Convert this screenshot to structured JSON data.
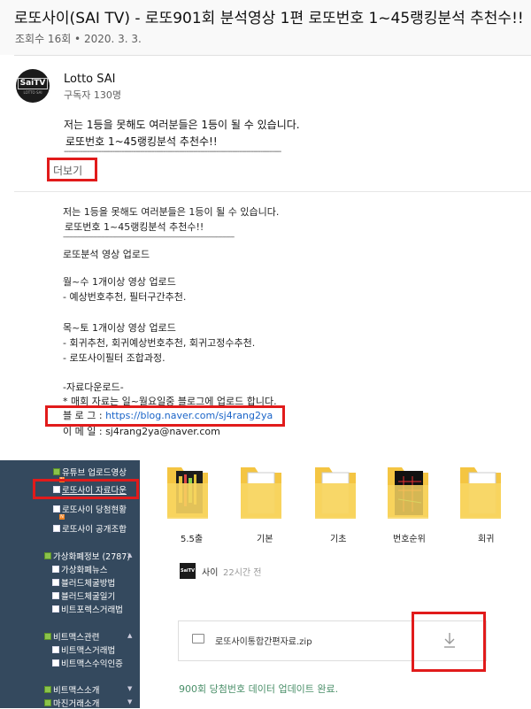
{
  "video": {
    "title": "로또사이(SAI TV) - 로또901회 분석영상 1편 로또번호 1~45랭킹분석 추천수!!",
    "meta": "조회수 16회 • 2020. 3. 3."
  },
  "channel": {
    "name": "Lotto SAI",
    "subscribers": "구독자 130명",
    "avatar_text": "SaiTV",
    "avatar_subtext": "LOTTO SAI"
  },
  "description": {
    "line1": "저는 1등을 못해도 여러분들은 1등이 될 수 있습니다.",
    "line2": "로또번호 1~45랭킹분석 추천수!!",
    "separator": "----------------------------------------------------------------------------------------------",
    "more_label": "더보기"
  },
  "expanded": {
    "line1": "저는 1등을 못해도 여러분들은 1등이 될 수 있습니다.",
    "line2": "로또번호 1~45랭킹분석 추천수!!",
    "separator": "--------------------------------------------------------------------------------------",
    "upload_heading": "로또분석 영상 업로드",
    "mon_wed": "월~수 1개이상 영상 업로드",
    "mon_wed_detail": "- 예상번호추천, 필터구간추천.",
    "thu_sat": "목~토 1개이상 영상 업로드",
    "thu_sat_detail1": "- 회귀추천, 회귀예상번호추천, 회귀고정수추천.",
    "thu_sat_detail2": "- 로또사이필터 조합과정.",
    "download_heading": "-자료다운로드-",
    "download_note": "* 매회 자료는 일~월요일중 블로그에 업로드 합니다.",
    "blog_label": "블 로 그 : ",
    "blog_url": "https://blog.naver.com/sj4rang2ya",
    "email_label": "이 메 일 : ",
    "email": "sj4rang2ya@naver.com"
  },
  "sidebar": {
    "items": [
      {
        "label": "유튜브 업로드영상"
      },
      {
        "label": "로또사이 자료다운"
      },
      {
        "label": "로또사이 당첨현황"
      },
      {
        "label": "로또사이 공개조합"
      },
      {
        "label": "가상화폐정보 (2787)"
      },
      {
        "label": "가상화폐뉴스"
      },
      {
        "label": "블러드체굴방법"
      },
      {
        "label": "블러드체굴일기"
      },
      {
        "label": "비트포렉스거래법"
      },
      {
        "label": "비트맥스관련"
      },
      {
        "label": "비트맥스거래법"
      },
      {
        "label": "비트맥스수익인증"
      },
      {
        "label": "비트맥스소개"
      },
      {
        "label": "마진거래소개"
      }
    ],
    "badge": "N"
  },
  "folders": [
    {
      "label": "5.5출"
    },
    {
      "label": "기본"
    },
    {
      "label": "기초"
    },
    {
      "label": "번호순위"
    },
    {
      "label": "회귀"
    }
  ],
  "post": {
    "author": "사이",
    "time": "22시간 전",
    "avatar_text": "SaiTV"
  },
  "attachment": {
    "file_name": "로또사이통합간편자료.zip"
  },
  "update_text": "900회 당첨번호 데이터 업데이트 완료.",
  "colors": {
    "highlight": "#e11b1b",
    "sidebar_bg": "#34495e",
    "link": "#1a64c8",
    "update_text": "#4a8f69"
  }
}
